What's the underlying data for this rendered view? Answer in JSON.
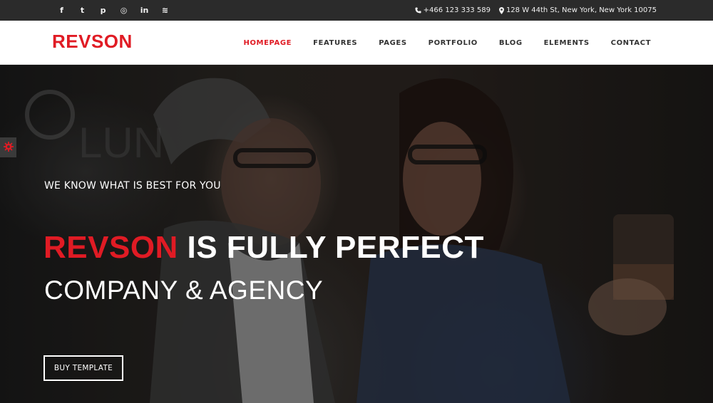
{
  "topbar": {
    "social": [
      {
        "icon": "facebook-icon",
        "glyph": "f"
      },
      {
        "icon": "twitter-icon",
        "glyph": "t"
      },
      {
        "icon": "pinterest-icon",
        "glyph": "p"
      },
      {
        "icon": "dribbble-icon",
        "glyph": "◎"
      },
      {
        "icon": "linkedin-icon",
        "glyph": "in"
      },
      {
        "icon": "rss-icon",
        "glyph": "≋"
      }
    ],
    "phone": "+466 123 333 589",
    "address": "128 W 44th St, New York, New York 10075"
  },
  "nav": {
    "logo": "REVSON",
    "items": [
      "HOMEPAGE",
      "FEATURES",
      "PAGES",
      "PORTFOLIO",
      "BLOG",
      "ELEMENTS",
      "CONTACT"
    ],
    "active_index": 0
  },
  "hero": {
    "tagline": "WE KNOW WHAT IS BEST FOR YOU",
    "headline_brand": "REVSON",
    "headline_rest": " IS FULLY PERFECT",
    "subhead": "COMPANY & AGENCY",
    "cta_label": "BUY TEMPLATE"
  },
  "colors": {
    "accent": "#e01b24",
    "topbar_bg": "#2b2b2b"
  }
}
